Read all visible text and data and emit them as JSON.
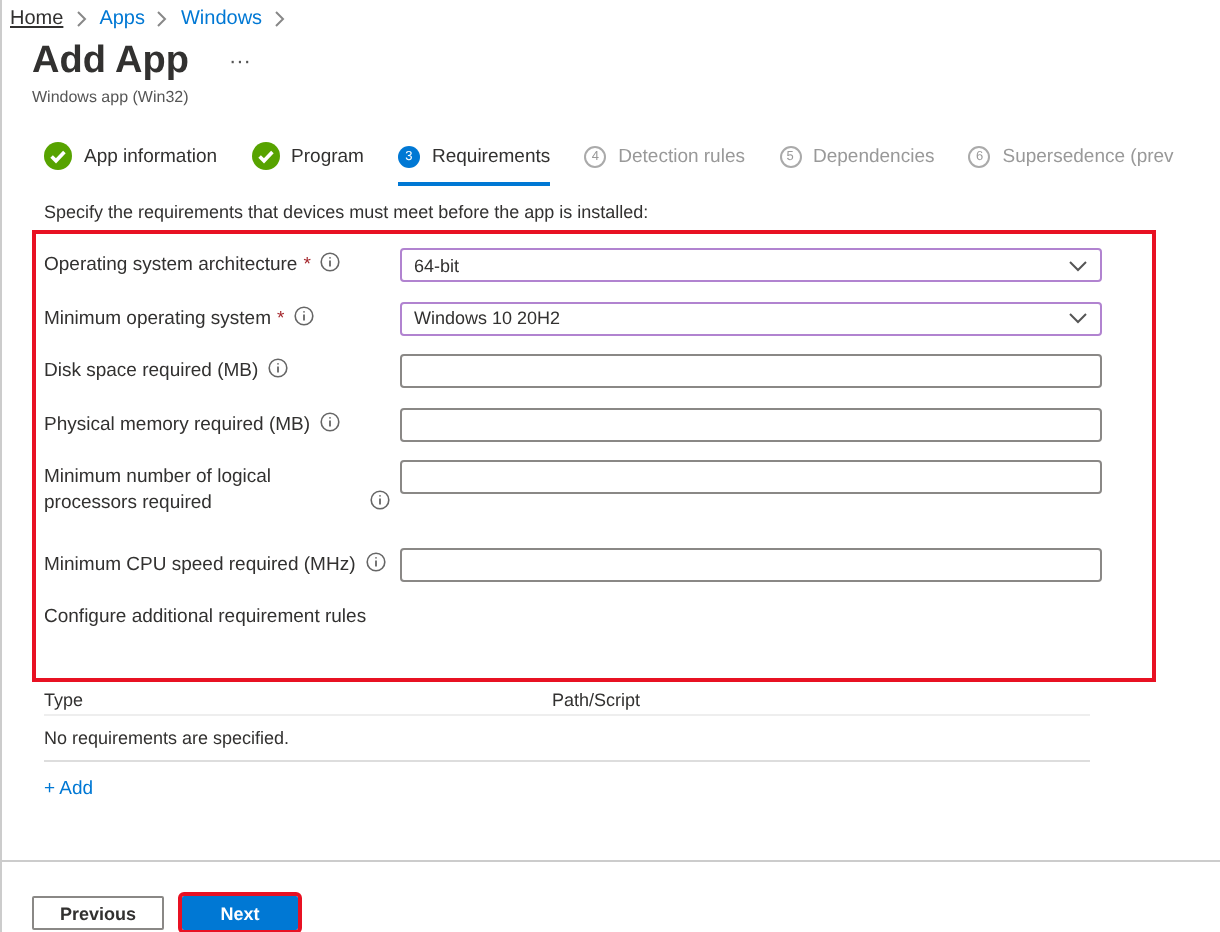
{
  "breadcrumb": [
    "Home",
    "Apps",
    "Windows"
  ],
  "page": {
    "title": "Add App",
    "more": "···",
    "subtitle": "Windows app (Win32)"
  },
  "steps": [
    {
      "label": "App information",
      "kind": "done",
      "selected": false
    },
    {
      "label": "Program",
      "kind": "done",
      "selected": false
    },
    {
      "number": "3",
      "label": "Requirements",
      "kind": "current",
      "selected": true
    },
    {
      "number": "4",
      "label": "Detection rules",
      "kind": "pending",
      "selected": false
    },
    {
      "number": "5",
      "label": "Dependencies",
      "kind": "pending",
      "selected": false
    },
    {
      "number": "6",
      "label": "Supersedence (prev",
      "kind": "pending",
      "selected": false
    }
  ],
  "description": "Specify the requirements that devices must meet before the app is installed:",
  "fields": [
    {
      "label": "Operating system architecture",
      "required_mark": "*",
      "kind": "dropdown",
      "value": "64-bit"
    },
    {
      "label": "Minimum operating system",
      "required_mark": "*",
      "kind": "dropdown",
      "value": "Windows 10 20H2"
    },
    {
      "label": "Disk space required (MB)",
      "kind": "text"
    },
    {
      "label": "Physical memory required (MB)",
      "kind": "text"
    },
    {
      "label": "Minimum number of logical processors required",
      "kind": "text"
    },
    {
      "label": "Minimum CPU speed required (MHz)",
      "kind": "text"
    }
  ],
  "additional_rules": {
    "heading": "Configure additional requirement rules",
    "columns": [
      "Type",
      "Path/Script"
    ],
    "empty_message": "No requirements are specified.",
    "add_link": "+ Add"
  },
  "buttons": [
    {
      "label": "Previous",
      "kind": "secondary",
      "highlighted": false
    },
    {
      "label": "Next",
      "kind": "primary",
      "highlighted": true
    }
  ]
}
